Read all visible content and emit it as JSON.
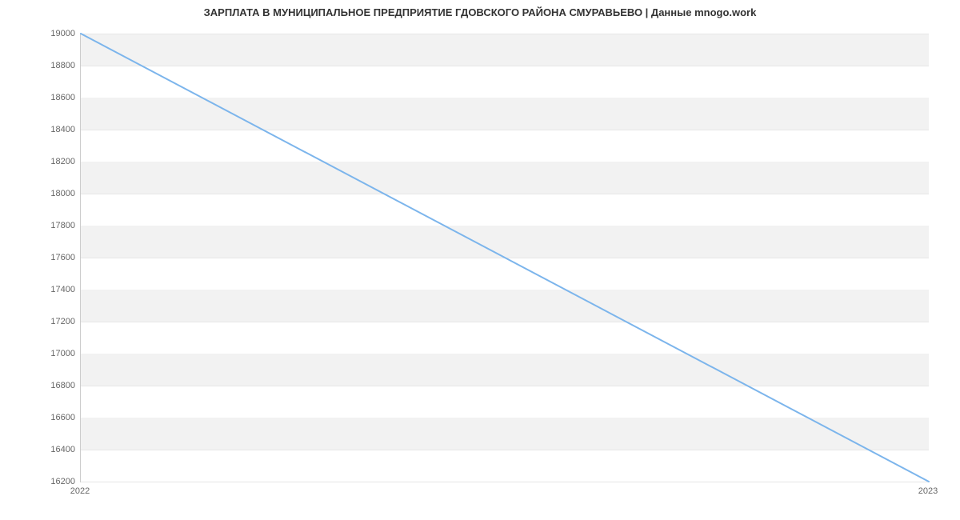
{
  "chart_data": {
    "type": "line",
    "title": "ЗАРПЛАТА В МУНИЦИПАЛЬНОЕ ПРЕДПРИЯТИЕ ГДОВСКОГО РАЙОНА СМУРАВЬЕВО | Данные mnogo.work",
    "x": [
      2022,
      2023
    ],
    "values": [
      19000,
      16200
    ],
    "x_ticks": [
      2022,
      2023
    ],
    "y_ticks": [
      16200,
      16400,
      16600,
      16800,
      17000,
      17200,
      17400,
      17600,
      17800,
      18000,
      18200,
      18400,
      18600,
      18800,
      19000
    ],
    "xlim": [
      2022,
      2023
    ],
    "ylim": [
      16200,
      19000
    ],
    "line_color": "#7cb5ec",
    "band_color": "#f2f2f2"
  }
}
